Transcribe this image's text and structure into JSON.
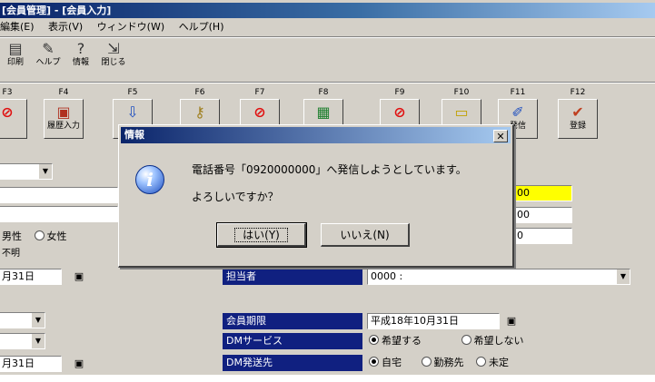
{
  "window": {
    "title": "[会員管理] - [会員入力]"
  },
  "menu": [
    "編集(E)",
    "表示(V)",
    "ウィンドウ(W)",
    "ヘルプ(H)"
  ],
  "toolbar": [
    {
      "icon": "printer-icon",
      "label": "印刷"
    },
    {
      "icon": "help-icon",
      "label": "ヘルプ"
    },
    {
      "icon": "info-icon",
      "label": "情報"
    },
    {
      "icon": "close-icon",
      "label": "閉じる"
    }
  ],
  "fkeys": [
    {
      "key": "F3",
      "icon": "no-entry-icon",
      "label": ""
    },
    {
      "key": "F4",
      "icon": "history-input-icon",
      "label": "履歴入力"
    },
    {
      "key": "F5",
      "icon": "import-icon",
      "label": ""
    },
    {
      "key": "F6",
      "icon": "key-icon",
      "label": ""
    },
    {
      "key": "F7",
      "icon": "no-entry-icon",
      "label": ""
    },
    {
      "key": "F8",
      "icon": "chart-icon",
      "label": ""
    },
    {
      "key": "F9",
      "icon": "no-entry-icon",
      "label": ""
    },
    {
      "key": "F10",
      "icon": "notepad-icon",
      "label": ""
    },
    {
      "key": "F11",
      "icon": "phone-pen-icon",
      "label": "発信"
    },
    {
      "key": "F12",
      "icon": "register-icon",
      "label": "登録"
    }
  ],
  "form": {
    "gender_male": "男性",
    "gender_female": "女性",
    "unknown": "不明",
    "date1": "月31日",
    "date2": "月31日",
    "field_yellow": "00",
    "field_b": "00",
    "field_c": "0",
    "assignee_label": "担当者",
    "assignee_value": "0000 :",
    "join_date_label": "会員期限",
    "join_date_value": "平成18年10月31日",
    "dm_service_label": "DMサービス",
    "dm_service_opt1": "希望する",
    "dm_service_opt2": "希望しない",
    "dm_dest_label": "DM発送先",
    "dm_dest_opt1": "自宅",
    "dm_dest_opt2": "勤務先",
    "dm_dest_opt3": "未定"
  },
  "dialog": {
    "title": "情報",
    "message": "電話番号「0920000000」へ発信しようとしています。",
    "question": "よろしいですか？",
    "yes": "はい(Y)",
    "no": "いいえ(N)"
  },
  "colors": {
    "titlebar": "#0a246a",
    "face": "#d4d0c8",
    "label_blue": "#102080",
    "highlight": "#ffff00"
  }
}
